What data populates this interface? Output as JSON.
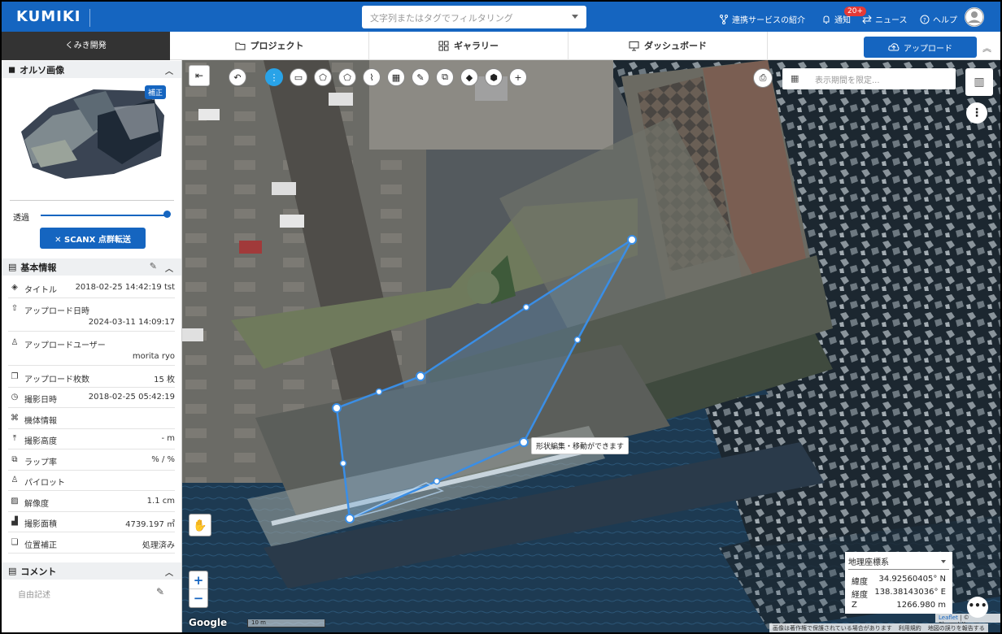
{
  "header": {
    "logo": "KUMIKI",
    "search_placeholder": "文字列またはタグでフィルタリング",
    "links": [
      {
        "label": "連携サービスの紹介",
        "icon": "link-icon"
      },
      {
        "label": "通知",
        "icon": "bell-icon"
      },
      {
        "label": "ニュース",
        "icon": "news-icon"
      },
      {
        "label": "ヘルプ",
        "icon": "help-icon"
      }
    ],
    "notification_count": "20+"
  },
  "nav": {
    "project_name": "くみき開発",
    "tabs": [
      {
        "label": "プロジェクト",
        "icon": "folder-icon"
      },
      {
        "label": "ギャラリー",
        "icon": "grid-icon"
      },
      {
        "label": "ダッシュボード",
        "icon": "monitor-icon"
      }
    ],
    "upload_label": "アップロード",
    "collapse_glyph": "︽"
  },
  "sidebar": {
    "ortho": {
      "title": "オルソ画像",
      "badge": "補正",
      "opacity_label": "透過",
      "opacity_value": 1.0,
      "scanx_label": "✕ SCANX 点群転送"
    },
    "basic": {
      "title": "基本情報",
      "rows": [
        {
          "icon": "layers-icon",
          "glyph": "◈",
          "label": "タイトル",
          "value": "2018-02-25 14:42:19 tst"
        },
        {
          "icon": "upload-icon",
          "glyph": "⇧",
          "label": "アップロード日時",
          "value": "2024-03-11 14:09:17"
        },
        {
          "icon": "user-icon",
          "glyph": "♙",
          "label": "アップロードユーザー",
          "value": "morita ryo"
        },
        {
          "icon": "images-icon",
          "glyph": "❐",
          "label": "アップロード枚数",
          "value": "15 枚"
        },
        {
          "icon": "clock-icon",
          "glyph": "◷",
          "label": "撮影日時",
          "value": "2018-02-25 05:42:19"
        },
        {
          "icon": "drone-icon",
          "glyph": "⌘",
          "label": "機体情報",
          "value": ""
        },
        {
          "icon": "altitude-icon",
          "glyph": "⤒",
          "label": "撮影高度",
          "value": "- m"
        },
        {
          "icon": "overlap-icon",
          "glyph": "⧉",
          "label": "ラップ率",
          "value": "% / %"
        },
        {
          "icon": "pilot-icon",
          "glyph": "♙",
          "label": "パイロット",
          "value": ""
        },
        {
          "icon": "resolution-icon",
          "glyph": "▨",
          "label": "解像度",
          "value": "1.1 cm"
        },
        {
          "icon": "area-icon",
          "glyph": "▟",
          "label": "撮影面積",
          "value": "4739.197 ㎡"
        },
        {
          "icon": "correction-icon",
          "glyph": "❏",
          "label": "位置補正",
          "value": "処理済み"
        }
      ]
    },
    "comment": {
      "title": "コメント",
      "placeholder": "自由記述"
    }
  },
  "map": {
    "toolbar": [
      {
        "name": "undo-icon",
        "glyph": "↶"
      },
      {
        "name": "more-vert-icon",
        "glyph": "⋮",
        "active": true
      },
      {
        "name": "ruler-icon",
        "glyph": "▭"
      },
      {
        "name": "polygon-icon",
        "glyph": "⬠"
      },
      {
        "name": "pentagon-icon",
        "glyph": "⬠"
      },
      {
        "name": "profile-icon",
        "glyph": "⌇"
      },
      {
        "name": "grid-icon",
        "glyph": "▦"
      },
      {
        "name": "pencil-icon",
        "glyph": "✎"
      },
      {
        "name": "copy-icon",
        "glyph": "⧉"
      },
      {
        "name": "eraser-icon",
        "glyph": "◆"
      },
      {
        "name": "cube-icon",
        "glyph": "⬢"
      },
      {
        "name": "plus-icon",
        "glyph": "+"
      }
    ],
    "date_placeholder": "表示期間を限定...",
    "tooltip": "形状編集・移動ができます",
    "scale_label": "10 m",
    "google_label": "Google",
    "zoom_in": "+",
    "zoom_out": "−",
    "coords": {
      "system": "地理座標系",
      "lat_label": "緯度",
      "lat_value": "34.92560405° N",
      "lon_label": "経度",
      "lon_value": "138.38143036° E",
      "z_label": "Z",
      "z_value": "1266.980 m"
    },
    "attribution": {
      "leaflet": "Leaflet",
      "rest": "| © SkymatiX"
    },
    "copyright": [
      "画像は著作権で保護されている場合があります",
      "利用規約",
      "地図の誤りを報告する"
    ]
  }
}
